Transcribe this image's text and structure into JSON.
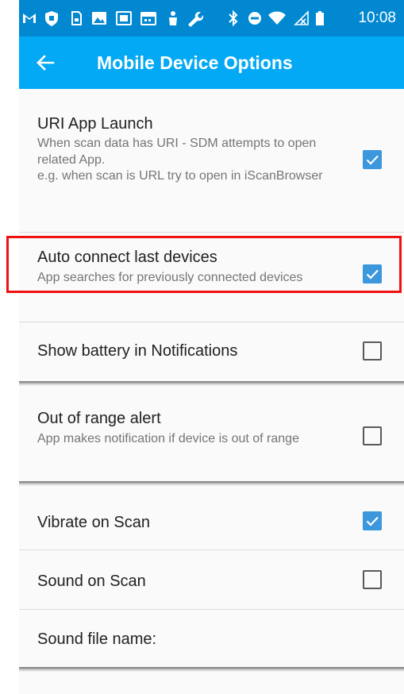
{
  "status_bar": {
    "time": "10:08",
    "icons": [
      "gmail-icon",
      "shield-icon",
      "sim-icon",
      "image-icon",
      "photo-icon",
      "calendar-icon",
      "person-icon",
      "wrench-icon",
      "bluetooth-icon",
      "do-not-disturb-icon",
      "wifi-icon",
      "no-signal-icon",
      "battery-icon"
    ]
  },
  "app_bar": {
    "title": "Mobile Device Options",
    "back_icon": "back-arrow-icon"
  },
  "colors": {
    "status_bar": "#0288d1",
    "app_bar": "#03a9f4",
    "checkbox_checked": "#3d97dc",
    "highlight": "#ee1111"
  },
  "settings": [
    {
      "title": "URI App Launch",
      "summary": "When scan data has URI - SDM attempts to open related App.\ne.g. when scan is URL try to open in iScanBrowser",
      "checked": true
    },
    {
      "title": "Auto connect last devices",
      "summary": "App searches for previously connected devices",
      "checked": true,
      "highlighted": true
    },
    {
      "title": "Show battery in Notifications",
      "summary": "",
      "checked": false
    },
    {
      "title": "Out of range alert",
      "summary": "App makes notification if device is out of range",
      "checked": false
    },
    {
      "title": "Vibrate on Scan",
      "summary": "",
      "checked": true
    },
    {
      "title": "Sound on Scan",
      "summary": "",
      "checked": false
    },
    {
      "title": "Sound file name:",
      "summary": ""
    }
  ]
}
